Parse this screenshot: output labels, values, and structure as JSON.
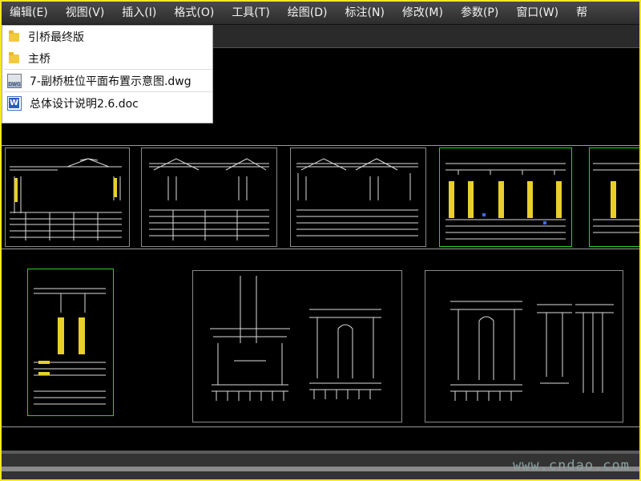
{
  "menubar": {
    "items": [
      "编辑(E)",
      "视图(V)",
      "插入(I)",
      "格式(O)",
      "工具(T)",
      "绘图(D)",
      "标注(N)",
      "修改(M)",
      "参数(P)",
      "窗口(W)",
      "帮"
    ]
  },
  "popup": {
    "items": [
      {
        "icon": "folder-icon",
        "label": "引桥最终版"
      },
      {
        "icon": "folder-icon",
        "label": "主桥"
      },
      {
        "icon": "dwg-file-icon",
        "label": "7-副桥桩位平面布置示意图.dwg"
      },
      {
        "icon": "word-doc-icon",
        "label": "总体设计说明2.6.doc"
      }
    ]
  },
  "watermark": "www.cndao.com",
  "colors": {
    "accent_border": "#f2ea1a",
    "sheet_highlight": "#26d626",
    "drawing_yellow": "#e8cf2a"
  }
}
